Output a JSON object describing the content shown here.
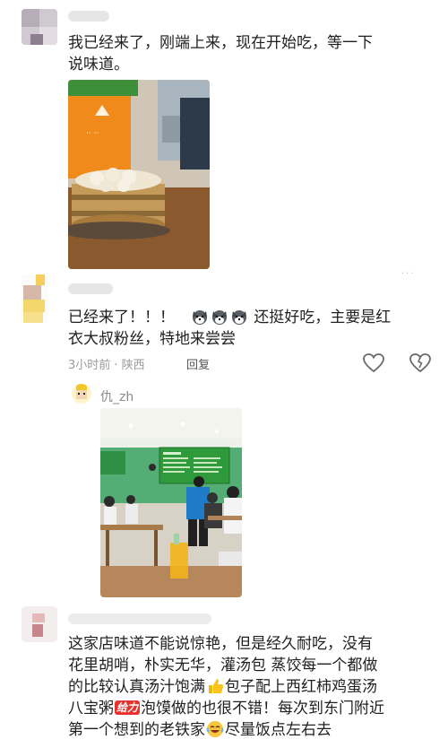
{
  "comment1": {
    "lines": [
      "我已经来了，刚端上来，现在开始吃，等一下",
      "说味道。"
    ]
  },
  "comment2": {
    "line1_prefix": "已经来了！！！",
    "line1_suffix": "还挺好吃，主要是红",
    "line2": "衣大叔粉丝，特地来尝尝",
    "time_location": "3小时前 · 陕西",
    "reply_label": "回复",
    "emoji_name": "dog-face-icon"
  },
  "comment3": {
    "username": "仇_zh"
  },
  "comment4": {
    "line1": "这家店味道不能说惊艳，但是经久耐吃，没有",
    "line2": "花里胡哨，朴实无华，灌汤包 蒸饺每一个都做",
    "line3_prefix": "的比较认真汤汁饱满",
    "line3_suffix": "包子配上西红柿鸡蛋汤",
    "line4_prefix": "八宝粥",
    "line4_badge": "给力",
    "line4_suffix": "泡馍做的也很不错！每次到东门附近",
    "line5_prefix": "第一个想到的老铁家",
    "line5_suffix": "尽量饭点左右去"
  },
  "colors": {
    "text": "#1f1f1f",
    "meta": "#9a9a9a",
    "menu_green": "#2e9a3c",
    "wall_green": "#4aa86a",
    "apron_orange": "#f08a1a"
  }
}
